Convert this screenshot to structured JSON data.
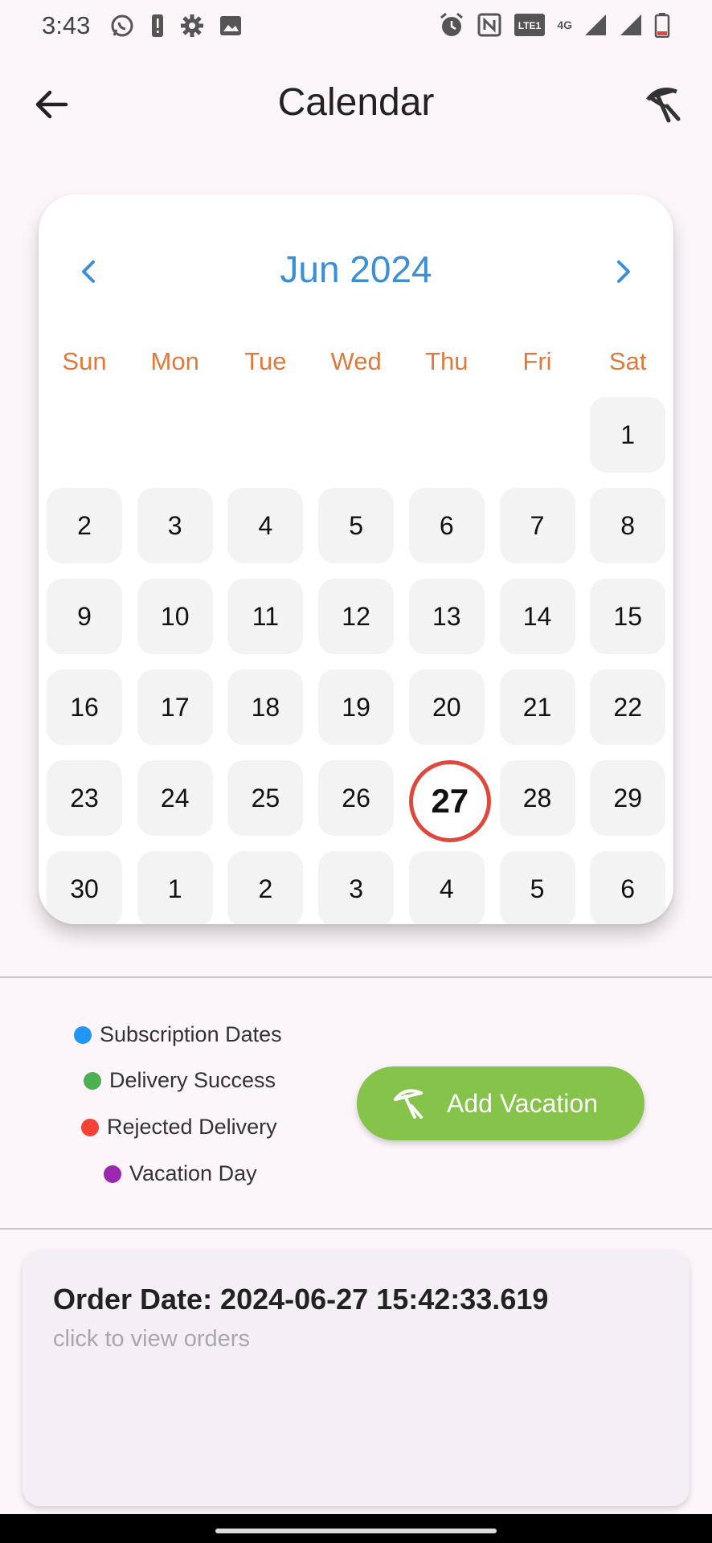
{
  "status_bar": {
    "time": "3:43",
    "icons_left": [
      "whatsapp-icon",
      "alert-icon",
      "settings-icon",
      "image-icon"
    ],
    "icons_right": [
      "alarm-icon",
      "nfc-icon",
      "volte-icon",
      "4g-icon",
      "signal-icon",
      "signal-icon",
      "battery-icon"
    ],
    "network_label": "4G"
  },
  "app_bar": {
    "title": "Calendar"
  },
  "calendar": {
    "month_label": "Jun 2024",
    "weekdays": [
      "Sun",
      "Mon",
      "Tue",
      "Wed",
      "Thu",
      "Fri",
      "Sat"
    ],
    "weeks": [
      [
        "",
        "",
        "",
        "",
        "",
        "",
        "1"
      ],
      [
        "2",
        "3",
        "4",
        "5",
        "6",
        "7",
        "8"
      ],
      [
        "9",
        "10",
        "11",
        "12",
        "13",
        "14",
        "15"
      ],
      [
        "16",
        "17",
        "18",
        "19",
        "20",
        "21",
        "22"
      ],
      [
        "23",
        "24",
        "25",
        "26",
        "27",
        "28",
        "29"
      ],
      [
        "30",
        "1",
        "2",
        "3",
        "4",
        "5",
        "6"
      ]
    ],
    "today": "27",
    "colors": {
      "month": "#3a8fd6",
      "weekday": "#e07a3c",
      "today_ring": "#e0473d"
    }
  },
  "legend": [
    {
      "label": "Subscription Dates",
      "color": "#2196f3"
    },
    {
      "label": "Delivery Success",
      "color": "#4caf50"
    },
    {
      "label": "Rejected Delivery",
      "color": "#f44336"
    },
    {
      "label": "Vacation Day",
      "color": "#9c27b0"
    }
  ],
  "add_vacation": {
    "label": "Add Vacation",
    "color": "#86c34a"
  },
  "order_card": {
    "title": "Order Date: 2024-06-27 15:42:33.619",
    "subtitle": "click to view orders"
  }
}
